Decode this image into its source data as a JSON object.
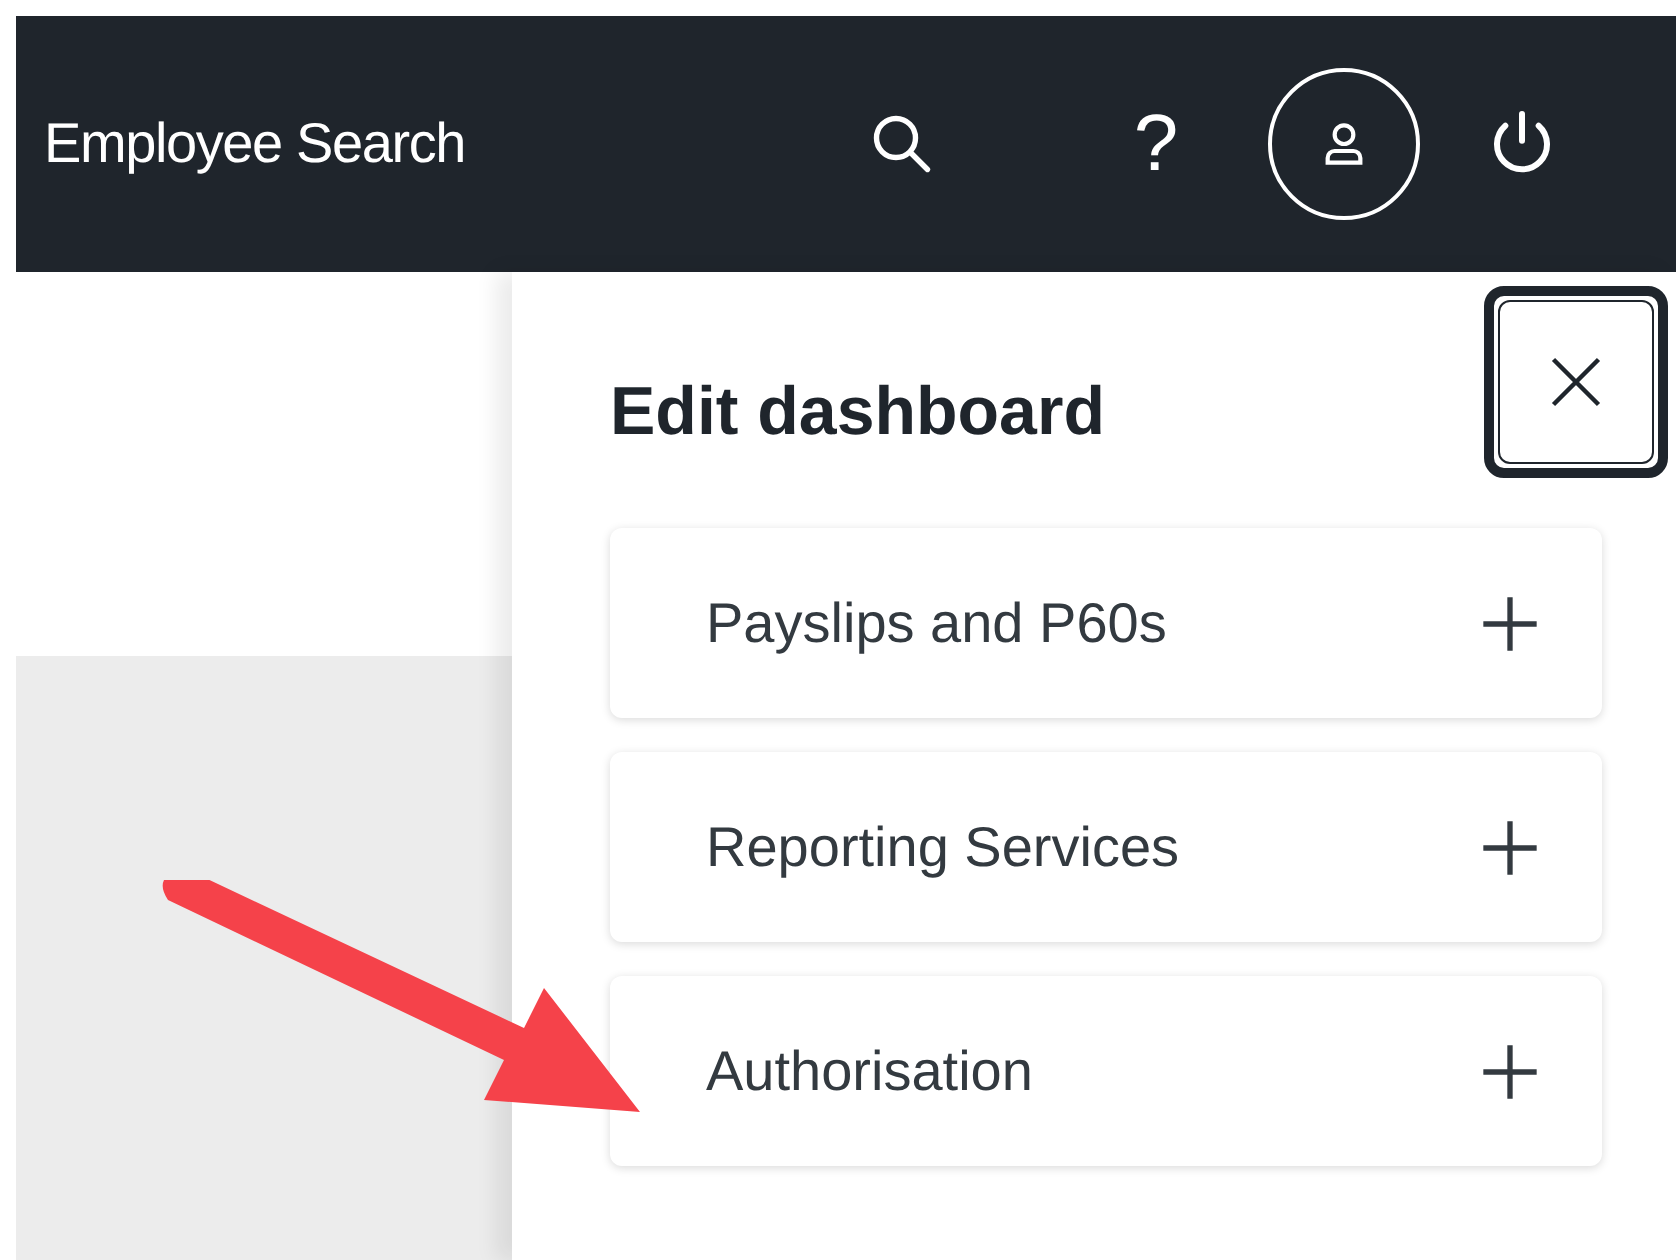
{
  "header": {
    "title": "Employee Search",
    "help": "?"
  },
  "panel": {
    "title": "Edit dashboard",
    "items": [
      {
        "label": "Payslips and P60s"
      },
      {
        "label": "Reporting Services"
      },
      {
        "label": "Authorisation"
      }
    ]
  }
}
